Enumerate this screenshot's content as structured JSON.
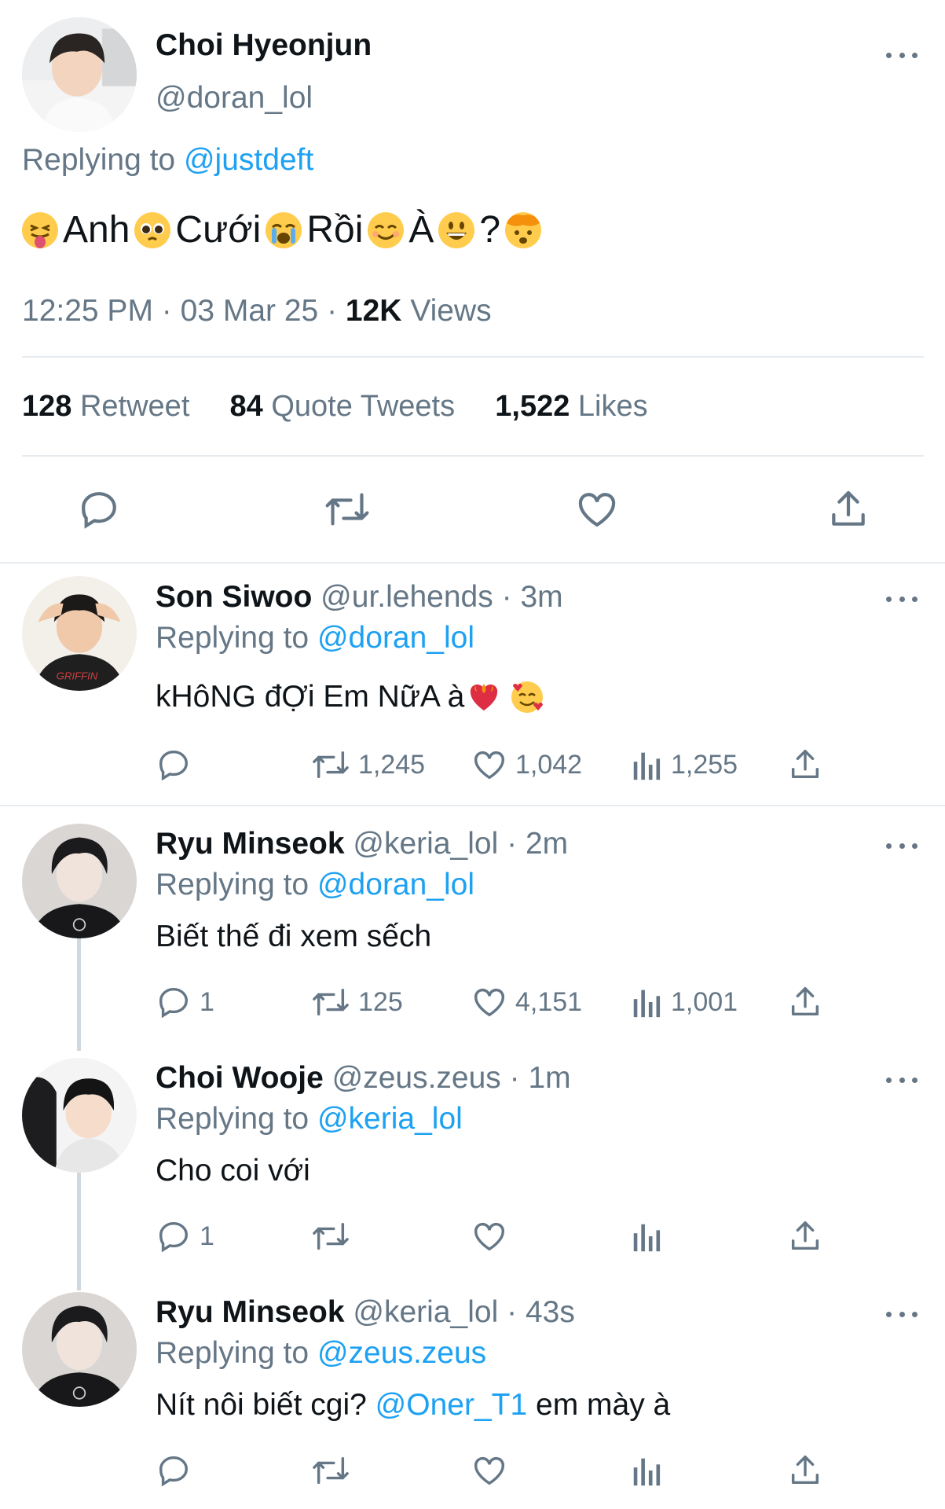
{
  "main_tweet": {
    "name": "Choi Hyeonjun",
    "handle": "@doran_lol",
    "replying_label": "Replying to",
    "replying_handle": "@justdeft",
    "words": [
      "Anh",
      "Cưới",
      "Rồi",
      "À",
      "?"
    ],
    "emojis": [
      "squinting-tongue-emoji",
      "pleading-face-emoji",
      "crying-face-emoji",
      "smiling-face-emoji",
      "grinning-face-emoji",
      "exploding-head-emoji"
    ],
    "time": "12:25 PM",
    "date": "03 Mar 25",
    "views_count": "12K",
    "views_label": "Views",
    "retweet_count": "128",
    "retweet_label": "Retweet",
    "quote_count": "84",
    "quote_label": "Quote Tweets",
    "likes_count": "1,522",
    "likes_label": "Likes"
  },
  "replies": [
    {
      "name": "Son Siwoo",
      "handle": "@ur.lehends",
      "time": "3m",
      "replying_label": "Replying to",
      "replying_handle": "@doran_lol",
      "text": "kHôNG đỢi Em NữA à",
      "text_emojis": [
        "heart-on-fire-emoji",
        "smiling-face-with-hearts-emoji"
      ],
      "reply_count": "",
      "retweet_count": "1,245",
      "like_count": "1,042",
      "views_count": "1,255"
    },
    {
      "name": "Ryu Minseok",
      "handle": "@keria_lol",
      "time": "2m",
      "replying_label": "Replying to",
      "replying_handle": "@doran_lol",
      "text": "Biết thế đi xem sếch",
      "reply_count": "1",
      "retweet_count": "125",
      "like_count": "4,151",
      "views_count": "1,001"
    },
    {
      "name": "Choi Wooje",
      "handle": "@zeus.zeus",
      "time": "1m",
      "replying_label": "Replying to",
      "replying_handle": "@keria_lol",
      "text": "Cho coi với",
      "reply_count": "1",
      "retweet_count": "",
      "like_count": "",
      "views_count": ""
    },
    {
      "name": "Ryu Minseok",
      "handle": "@keria_lol",
      "time": "43s",
      "replying_label": "Replying to",
      "replying_handle": "@zeus.zeus",
      "text_before": "Nít nôi biết cgi?",
      "mention": "@Oner_T1",
      "text_after": "em mày à",
      "reply_count": "",
      "retweet_count": "",
      "like_count": "",
      "views_count": ""
    }
  ],
  "separator": "·",
  "colors": {
    "accent": "#1da1f2",
    "secondary_text": "#657786",
    "divider": "#e6ecf0"
  }
}
